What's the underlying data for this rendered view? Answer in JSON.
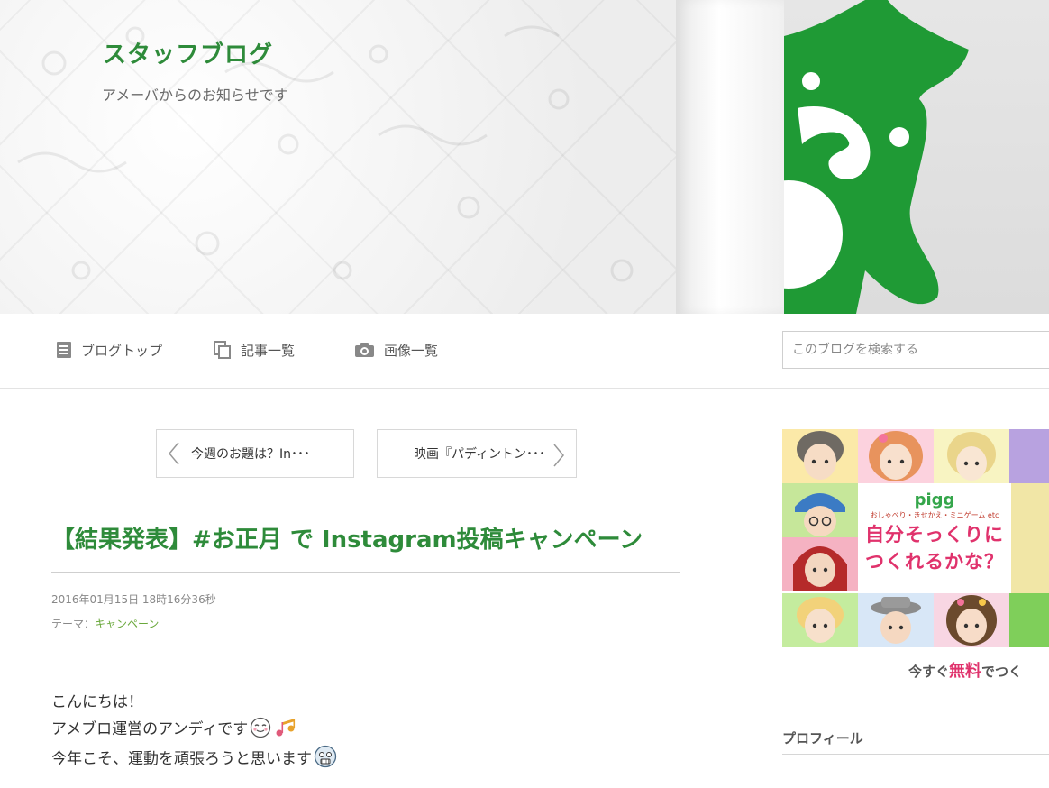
{
  "header": {
    "blog_title": "スタッフブログ",
    "blog_description": "アメーバからのお知らせです"
  },
  "nav": {
    "items": [
      {
        "label": "ブログトップ",
        "icon": "document-icon"
      },
      {
        "label": "記事一覧",
        "icon": "copy-icon"
      },
      {
        "label": "画像一覧",
        "icon": "camera-icon"
      }
    ],
    "search_placeholder": "このブログを検索する"
  },
  "pager": {
    "prev_label": "今週のお題は？In･･･",
    "next_label": "映画『パディントン･･･"
  },
  "entry": {
    "title": "【結果発表】#お正月 で Instagram投稿キャンペーン",
    "date": "2016年01月15日 18時16分36秒",
    "theme_label": "テーマ：",
    "theme_value": "キャンペーン",
    "body_lines": [
      "こんにちは！",
      "アメブロ運営のアンディです",
      "今年こそ、運動を頑張ろうと思います"
    ]
  },
  "sidebar": {
    "ad": {
      "logo": "pigg",
      "subtitle": "おしゃべり・きせかえ・ミニゲーム etc",
      "headline_line1": "自分そっくりに",
      "headline_line2": "つくれるかな？",
      "cta_prefix": "今すぐ",
      "cta_emphasis": "無料",
      "cta_suffix": "でつく"
    },
    "profile_title": "プロフィール"
  },
  "colors": {
    "brand_green": "#2e8b3a",
    "theme_link": "#6aa83c",
    "ad_pink": "#e0326c"
  }
}
